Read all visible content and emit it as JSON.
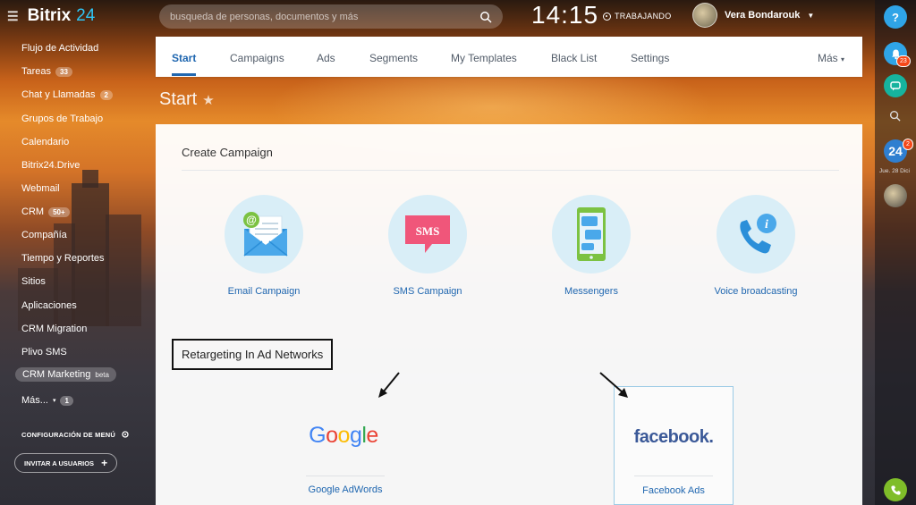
{
  "topbar": {
    "logo_part1": "Bitrix",
    "logo_part2": "24",
    "search_placeholder": "busqueda de personas, documentos y más",
    "clock": "14:15",
    "work_status": "TRABAJANDO",
    "user_name": "Vera Bondarouk"
  },
  "sidebar": {
    "items": [
      {
        "label": "Flujo de Actividad"
      },
      {
        "label": "Tareas",
        "count": "33"
      },
      {
        "label": "Chat y Llamadas",
        "count": "2"
      },
      {
        "label": "Grupos de Trabajo"
      },
      {
        "label": "Calendario"
      },
      {
        "label": "Bitrix24.Drive"
      },
      {
        "label": "Webmail"
      },
      {
        "label": "CRM",
        "count": "50+"
      },
      {
        "label": "Compañía"
      },
      {
        "label": "Tiempo y Reportes"
      },
      {
        "label": "Sitios"
      },
      {
        "label": "Aplicaciones"
      },
      {
        "label": "CRM Migration"
      },
      {
        "label": "Plivo SMS"
      },
      {
        "label": "CRM Marketing",
        "sup": "beta"
      },
      {
        "label": "Más...",
        "count": "1"
      }
    ],
    "config_label": "CONFIGURACIÓN DE MENÚ",
    "invite_label": "INVITAR A USUARIOS"
  },
  "rightbar": {
    "help_label": "?",
    "notif_count": "23",
    "b24_label": "24",
    "b24_badge": "2",
    "date": "Jue. 28 Dici"
  },
  "tabs": {
    "start": "Start",
    "campaigns": "Campaigns",
    "ads": "Ads",
    "segments": "Segments",
    "templates": "My Templates",
    "blacklist": "Black List",
    "settings": "Settings",
    "more": "Más"
  },
  "page_title": "Start",
  "create_campaign": {
    "title": "Create Campaign",
    "tiles": [
      {
        "label": "Email Campaign",
        "icon": "email-icon"
      },
      {
        "label": "SMS Campaign",
        "icon": "sms-icon",
        "icon_text": "SMS"
      },
      {
        "label": "Messengers",
        "icon": "messenger-phone-icon"
      },
      {
        "label": "Voice broadcasting",
        "icon": "voice-phone-icon"
      }
    ]
  },
  "retargeting": {
    "title": "Retargeting In Ad Networks",
    "google_logo": "Google",
    "google_label": "Google AdWords",
    "facebook_logo": "facebook.",
    "facebook_label": "Facebook Ads"
  },
  "colors": {
    "accent_blue": "#2067b0",
    "logo_cyan": "#2fc6f6",
    "badge_red": "#f54819",
    "tile_circle": "#d9eef7"
  }
}
